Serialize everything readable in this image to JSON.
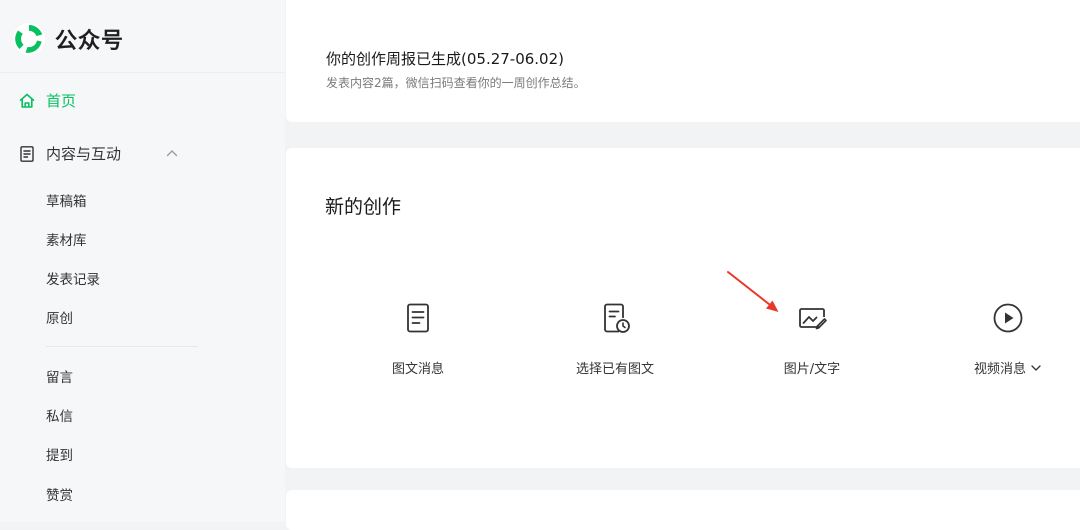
{
  "brand": {
    "name": "公众号",
    "color": "#07c160"
  },
  "sidebar": {
    "home": {
      "label": "首页",
      "icon": "home-icon",
      "active": true
    },
    "content_group": {
      "label": "内容与互动",
      "icon": "document-icon",
      "expanded": true,
      "items_a": [
        "草稿箱",
        "素材库",
        "发表记录",
        "原创"
      ],
      "items_b": [
        "留言",
        "私信",
        "提到",
        "赞赏"
      ]
    }
  },
  "weekly_report": {
    "title": "你的创作周报已生成(05.27-06.02)",
    "desc": "发表内容2篇，微信扫码查看你的一周创作总结。"
  },
  "creation": {
    "title": "新的创作",
    "items": [
      {
        "label": "图文消息",
        "icon": "article-icon"
      },
      {
        "label": "选择已有图文",
        "icon": "existing-article-icon"
      },
      {
        "label": "图片/文字",
        "icon": "image-text-icon"
      },
      {
        "label": "视频消息",
        "icon": "video-play-icon",
        "dropdown": true
      }
    ]
  },
  "annotation": {
    "arrow_color": "#e8382a",
    "points_to": "图片/文字"
  }
}
